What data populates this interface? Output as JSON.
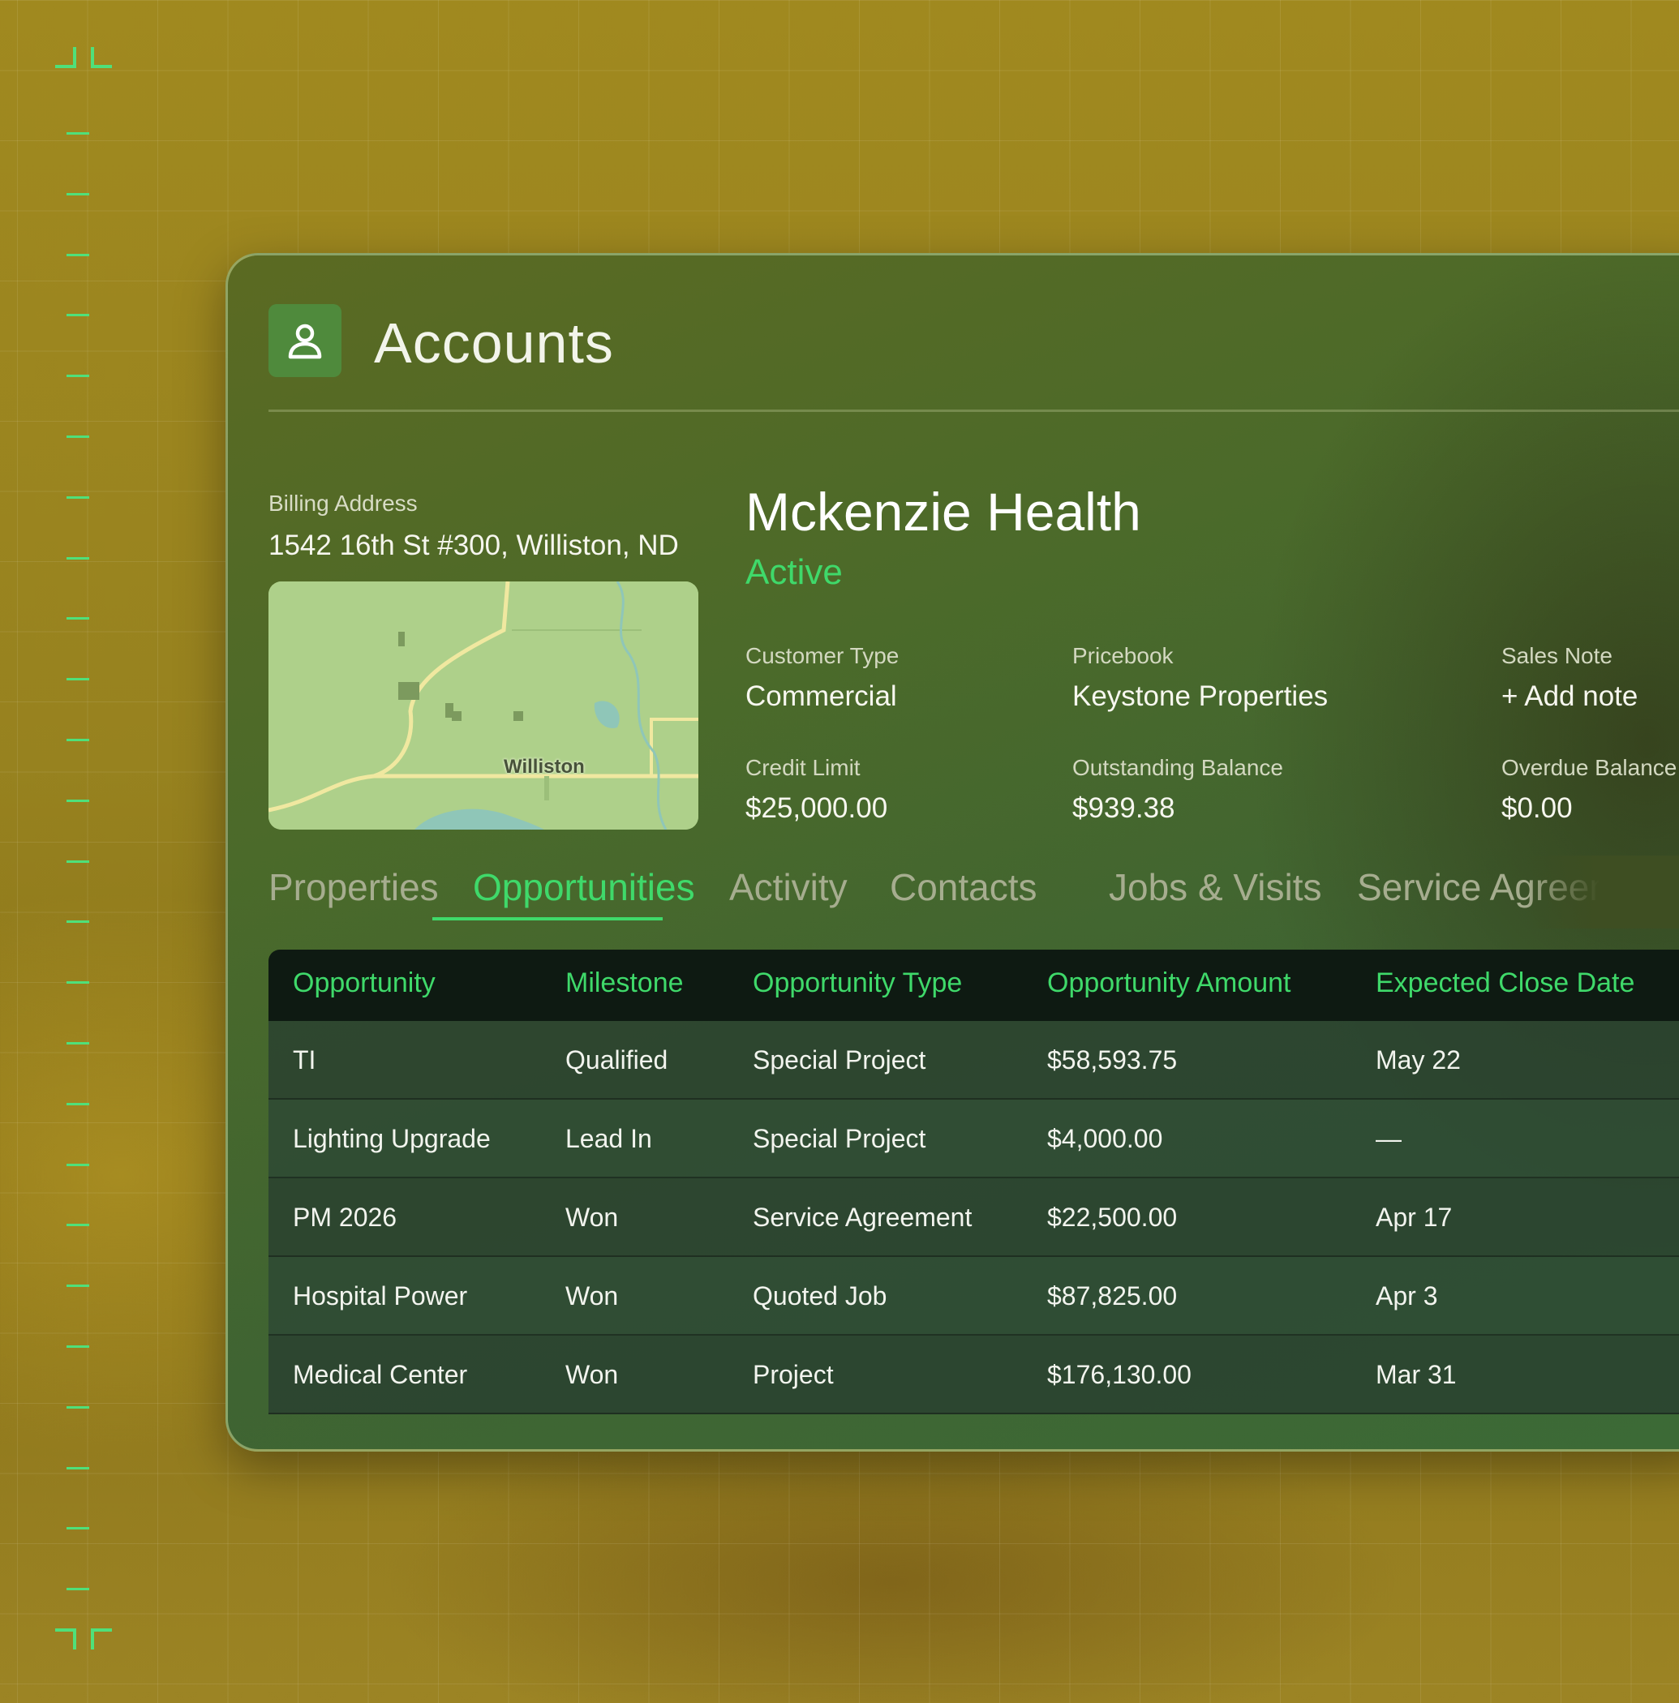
{
  "header": {
    "title": "Accounts",
    "icon": "user-icon"
  },
  "billing": {
    "label": "Billing Address",
    "address": "1542 16th St #300, Williston, ND",
    "map_label": "Williston"
  },
  "account": {
    "name": "Mckenzie Health",
    "status": "Active",
    "status_color": "#3fd96a",
    "fields": {
      "customer_type": {
        "label": "Customer Type",
        "value": "Commercial"
      },
      "pricebook": {
        "label": "Pricebook",
        "value": "Keystone Properties"
      },
      "sales_note": {
        "label": "Sales Note",
        "value": "+ Add note"
      },
      "credit_limit": {
        "label": "Credit Limit",
        "value": "$25,000.00"
      },
      "outstanding_balance": {
        "label": "Outstanding Balance",
        "value": "$939.38"
      },
      "overdue_balance": {
        "label": "Overdue Balance",
        "value": "$0.00"
      }
    }
  },
  "tabs": [
    {
      "label": "Properties",
      "active": false
    },
    {
      "label": "Opportunities",
      "active": true
    },
    {
      "label": "Activity",
      "active": false
    },
    {
      "label": "Contacts",
      "active": false
    },
    {
      "label": "Jobs & Visits",
      "active": false
    },
    {
      "label": "Service Agreements",
      "active": false
    }
  ],
  "table": {
    "columns": [
      "Opportunity",
      "Milestone",
      "Opportunity Type",
      "Opportunity Amount",
      "Expected Close Date"
    ],
    "rows": [
      [
        "TI",
        "Qualified",
        "Special Project",
        "$58,593.75",
        "May 22"
      ],
      [
        "Lighting Upgrade",
        "Lead In",
        "Special Project",
        "$4,000.00",
        "—"
      ],
      [
        "PM 2026",
        "Won",
        "Service Agreement",
        "$22,500.00",
        "Apr 17"
      ],
      [
        "Hospital Power",
        "Won",
        "Quoted Job",
        "$87,825.00",
        "Apr 3"
      ],
      [
        "Medical Center",
        "Won",
        "Project",
        "$176,130.00",
        "Mar 31"
      ]
    ]
  },
  "colors": {
    "accent": "#3fd96a",
    "ruler": "#4fe07a",
    "table_header": "#0e1a12"
  }
}
